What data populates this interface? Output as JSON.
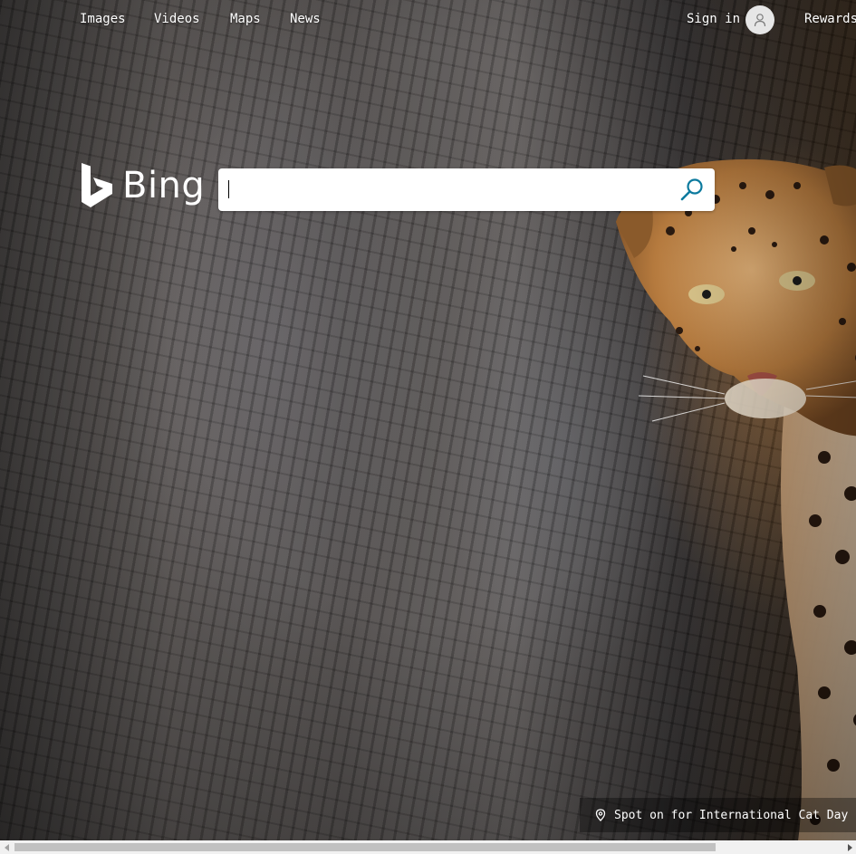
{
  "nav": {
    "links": [
      "Images",
      "Videos",
      "Maps",
      "News"
    ],
    "sign_in": "Sign in",
    "rewards": "Rewards"
  },
  "logo": {
    "text": "Bing"
  },
  "search": {
    "value": "",
    "placeholder": ""
  },
  "caption": {
    "text": "Spot on for International Cat Day"
  },
  "icons": {
    "avatar": "user-icon",
    "search": "search-icon",
    "caption": "location-pin-icon",
    "logo": "bing-logo-icon"
  },
  "colors": {
    "nav_text": "#ffffff",
    "search_bg": "#ffffff",
    "search_icon": "#0c7a9e",
    "avatar_bg": "#e6e6e6"
  }
}
